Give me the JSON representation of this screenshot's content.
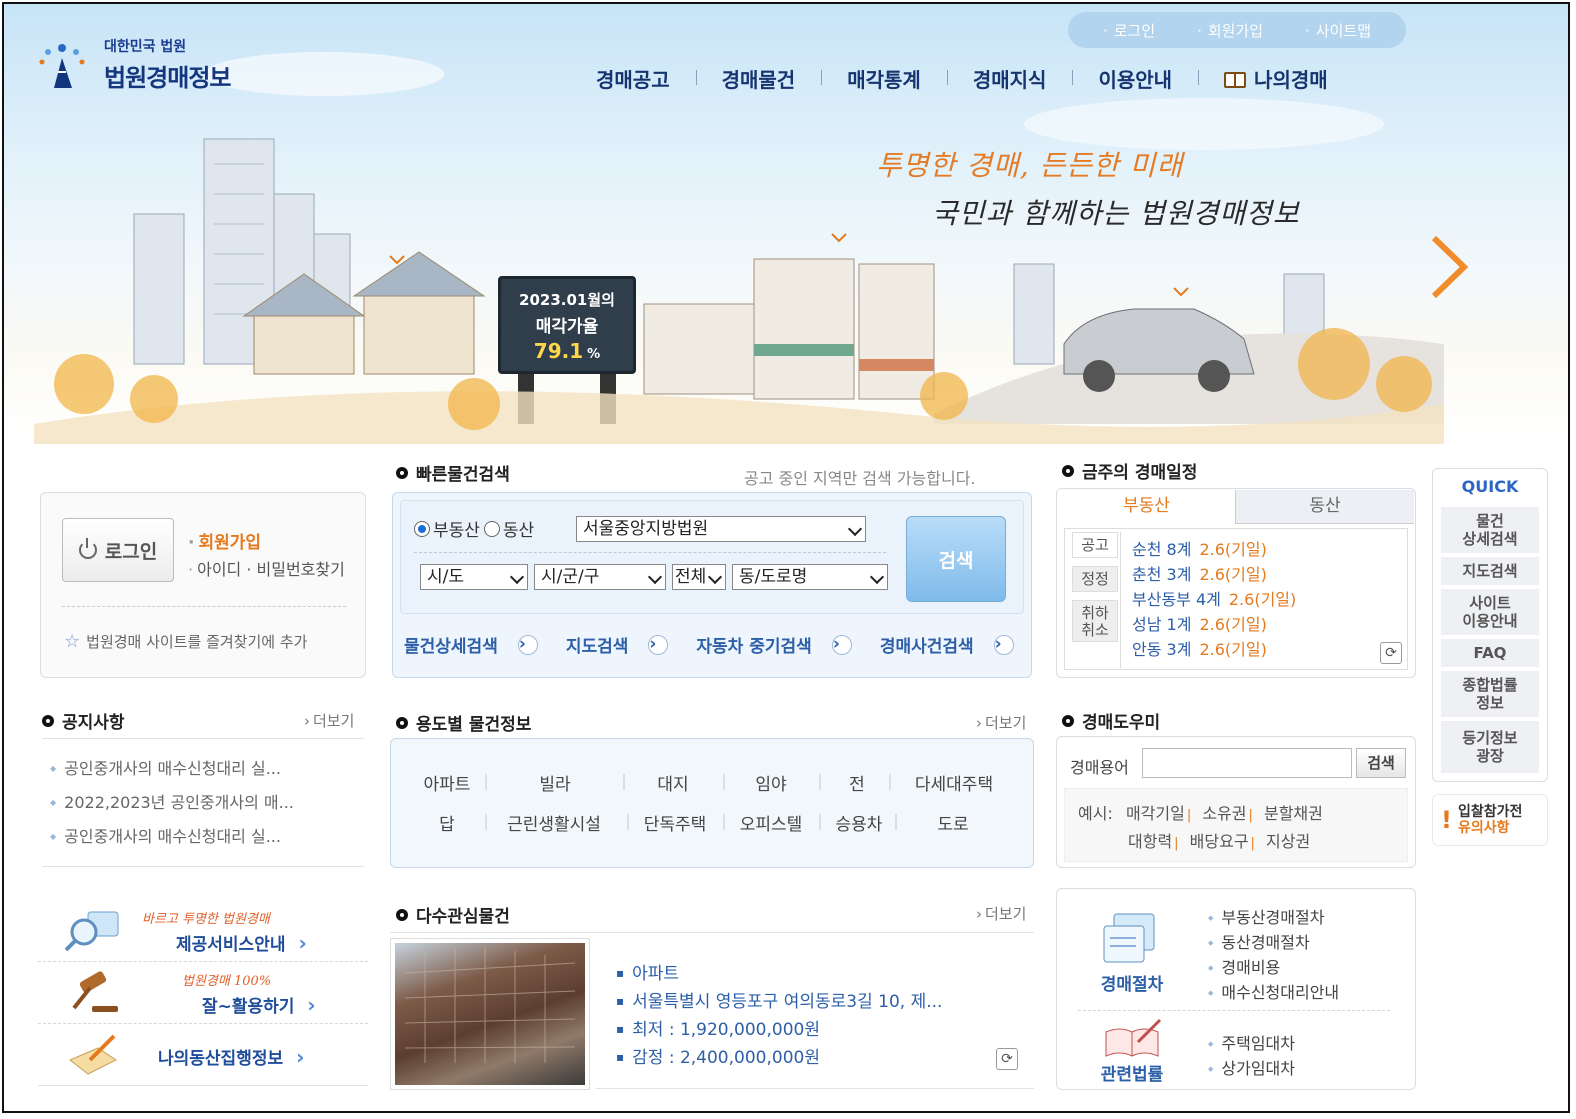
{
  "header": {
    "logo_small": "대한민국 법원",
    "logo_big": "법원경매정보",
    "util_links": [
      "로그인",
      "회원가입",
      "사이트맵"
    ],
    "nav": [
      "경매공고",
      "경매물건",
      "매각통계",
      "경매지식",
      "이용안내",
      "나의경매"
    ]
  },
  "hero": {
    "slogan1": "투명한 경매, 든든한 미래",
    "slogan2": "국민과 함께하는 법원경매정보",
    "billboard_line1": "2023.01월의",
    "billboard_line2": "매각가율",
    "billboard_rate": "79.1",
    "billboard_unit": "%"
  },
  "login": {
    "button": "로그인",
    "join": "회원가입",
    "find": "아이디 · 비밀번호찾기",
    "favorite": "법원경매 사이트를 즐겨찾기에 추가"
  },
  "notice": {
    "title": "공지사항",
    "more": "더보기",
    "items": [
      "공인중개사의 매수신청대리 실...",
      "2022,2023년 공인중개사의 매...",
      "공인중개사의 매수신청대리 실..."
    ]
  },
  "services": [
    {
      "sub": "바르고 투명한 법원경매",
      "main": "제공서비스안내"
    },
    {
      "sub": "법원경매 100%",
      "main": "잘~활용하기"
    },
    {
      "sub": "",
      "main": "나의동산집행정보"
    }
  ],
  "quick_search": {
    "title": "빠른물건검색",
    "hint": "공고 중인 지역만 검색 가능합니다.",
    "radio_realestate": "부동산",
    "radio_movable": "동산",
    "court": "서울중앙지방법원",
    "sido": "시/도",
    "sigungu": "시/군/구",
    "all": "전체",
    "dong": "동/도로명",
    "search": "검색",
    "links": [
      "물건상세검색",
      "지도검색",
      "자동차 중기검색",
      "경매사건검색"
    ]
  },
  "usage": {
    "title": "용도별 물건정보",
    "more": "더보기",
    "row1": [
      "아파트",
      "빌라",
      "대지",
      "임야",
      "전",
      "다세대주택"
    ],
    "row2": [
      "답",
      "근린생활시설",
      "단독주택",
      "오피스텔",
      "승용차",
      "도로"
    ]
  },
  "interest": {
    "title": "다수관심물건",
    "more": "더보기",
    "type": "아파트",
    "address": "서울특별시 영등포구 여의동로3길 10, 제...",
    "min_price": "최저 : 1,920,000,000원",
    "appraisal": "감정 : 2,400,000,000원"
  },
  "schedule": {
    "title": "금주의 경매일정",
    "tab_realestate": "부동산",
    "tab_movable": "동산",
    "side": [
      "공고",
      "정정",
      "취하",
      "취소"
    ],
    "items": [
      {
        "court": "순천 8계",
        "date": "2.6",
        "day": "(기일)"
      },
      {
        "court": "춘천 3계",
        "date": "2.6",
        "day": "(기일)"
      },
      {
        "court": "부산동부 4계",
        "date": "2.6",
        "day": "(기일)"
      },
      {
        "court": "성남 1계",
        "date": "2.6",
        "day": "(기일)"
      },
      {
        "court": "안동 3계",
        "date": "2.6",
        "day": "(기일)"
      }
    ]
  },
  "helper": {
    "title": "경매도우미",
    "term_label": "경매용어",
    "search": "검색",
    "example_label": "예시:",
    "row1": [
      "매각기일",
      "소유권",
      "분할채권"
    ],
    "row2": [
      "대항력",
      "배당요구",
      "지상권"
    ],
    "proc_title": "경매절차",
    "proc_items": [
      "부동산경매절차",
      "동산경매절차",
      "경매비용",
      "매수신청대리안내"
    ],
    "law_title": "관련법률",
    "law_items": [
      "주택임대차",
      "상가임대차"
    ]
  },
  "quick_bar": {
    "title": "QUICK",
    "items": [
      "물건\n상세검색",
      "지도검색",
      "사이트\n이용안내",
      "FAQ",
      "종합법률\n정보",
      "등기정보\n광장"
    ],
    "warn_line1": "입찰참가전",
    "warn_line2": "유의사항"
  },
  "colors": {
    "brand": "#14367f",
    "accent": "#e57a1c",
    "link": "#2d5fa8"
  }
}
